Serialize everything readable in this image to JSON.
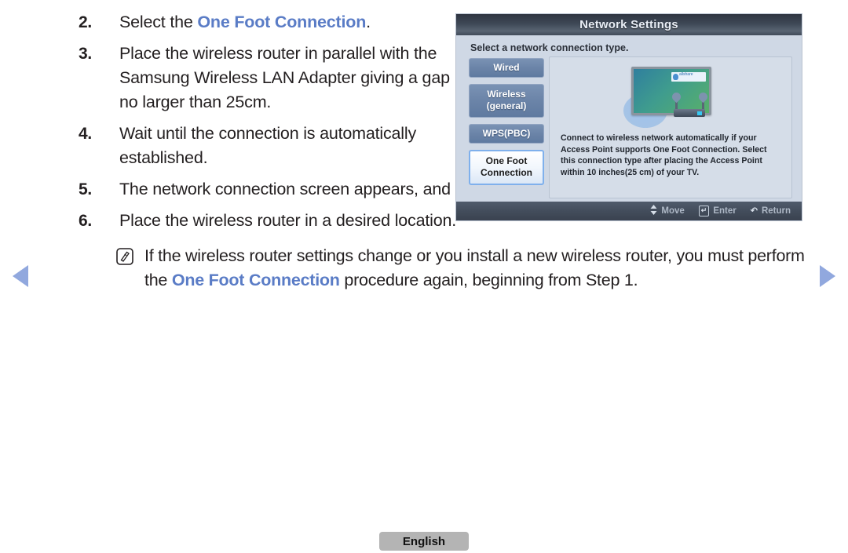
{
  "nav": {
    "prev_icon": "triangle-left-icon",
    "next_icon": "triangle-right-icon",
    "arrow_color": "#91a8de"
  },
  "accent_color": "#5a7cc6",
  "steps": [
    {
      "number": "2.",
      "prefix": "Select the ",
      "highlight": "One Foot Connection",
      "suffix": ".",
      "narrow": true
    },
    {
      "number": "3.",
      "prefix": "Place the wireless router in parallel with the Samsung Wireless LAN Adapter giving a gap no larger than 25cm.",
      "highlight": "",
      "suffix": "",
      "narrow": true
    },
    {
      "number": "4.",
      "prefix": "Wait until the connection is automatically established.",
      "highlight": "",
      "suffix": "",
      "narrow": true
    },
    {
      "number": "5.",
      "prefix": "The network connection screen appears, and network setting is done.",
      "highlight": "",
      "suffix": "",
      "narrow": false
    },
    {
      "number": "6.",
      "prefix": "Place the wireless router in a desired location.",
      "highlight": "",
      "suffix": "",
      "narrow": false
    }
  ],
  "note": {
    "icon": "note-pencil-icon",
    "prefix": "If the wireless router settings change or you install a new wireless router, you must perform the ",
    "highlight": "One Foot Connection",
    "suffix": " procedure again, beginning from Step 1."
  },
  "tv_panel": {
    "title": "Network Settings",
    "subtitle": "Select a network connection type.",
    "menu": [
      {
        "label": "Wired",
        "selected": false,
        "tall": false
      },
      {
        "label": "Wireless\n(general)",
        "line1": "Wireless",
        "line2": "(general)",
        "selected": false,
        "tall": true
      },
      {
        "label": "WPS(PBC)",
        "selected": false,
        "tall": false
      },
      {
        "label": "One Foot\nConnection",
        "line1": "One Foot",
        "line2": "Connection",
        "selected": true,
        "tall": true
      }
    ],
    "description": "Connect to wireless network automatically if your Access Point supports One Foot Connection. Select this connection type after placing the Access Point within 10 inches(25 cm) of your TV.",
    "illustration": {
      "tv_logo_text": "allshare",
      "icons": [
        "tv-icon",
        "signal-blob-icon",
        "wireless-router-icon"
      ]
    },
    "bottom_bar": [
      {
        "icon": "updown-arrow-icon",
        "glyph": "♦",
        "label": "Move"
      },
      {
        "icon": "enter-key-icon",
        "glyph": "↵",
        "label": "Enter"
      },
      {
        "icon": "return-arrow-icon",
        "glyph": "↶",
        "label": "Return"
      }
    ]
  },
  "footer": {
    "language_label": "English"
  }
}
